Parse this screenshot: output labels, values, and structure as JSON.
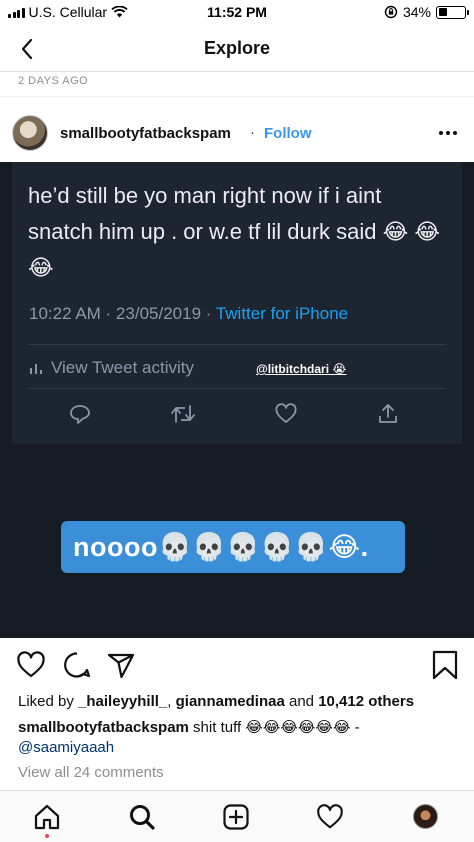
{
  "status_bar": {
    "carrier": "U.S. Cellular",
    "time": "11:52 PM",
    "battery_percent": "34%",
    "battery_level": 0.34,
    "icons": [
      "signal-icon",
      "wifi-icon",
      "rotation-lock-icon",
      "battery-icon"
    ]
  },
  "nav": {
    "title": "Explore",
    "back_icon": "chevron-left-icon"
  },
  "post": {
    "timestamp": "2 DAYS AGO",
    "username": "smallbootyfatbackspam",
    "separator": "·",
    "follow_label": "Follow",
    "more_icon": "ellipsis-icon"
  },
  "media": {
    "tweet_text": "he’d still be yo man right now if i aint snatch him up . or w.e tf lil durk said 😂 😂😂",
    "tweet_time": "10:22 AM · 23/05/2019 · ",
    "tweet_source": "Twitter for iPhone",
    "tweet_activity": "View Tweet activity",
    "watermark": "@litbitchdari 😭",
    "overlay_caption": "noooo💀💀💀💀💀😂."
  },
  "likes": {
    "prefix": "Liked by ",
    "user1": "_haileyyhill_",
    "sep": ", ",
    "user2": "giannamedinaa",
    "mid": " and ",
    "count": "10,412 others"
  },
  "caption": {
    "username": "smallbootyfatbackspam",
    "text": " shit tuff 😂😂😂😂😂😂 - ",
    "mention": "@saamiyaaah"
  },
  "comments": {
    "view_all": "View all 24 comments"
  },
  "colors": {
    "accent": "#3897f0",
    "media_bg": "#151b22",
    "tweet_bg": "#1c2530",
    "caption_box": "#3b8ed8",
    "notification_dot": "#ed4956"
  }
}
